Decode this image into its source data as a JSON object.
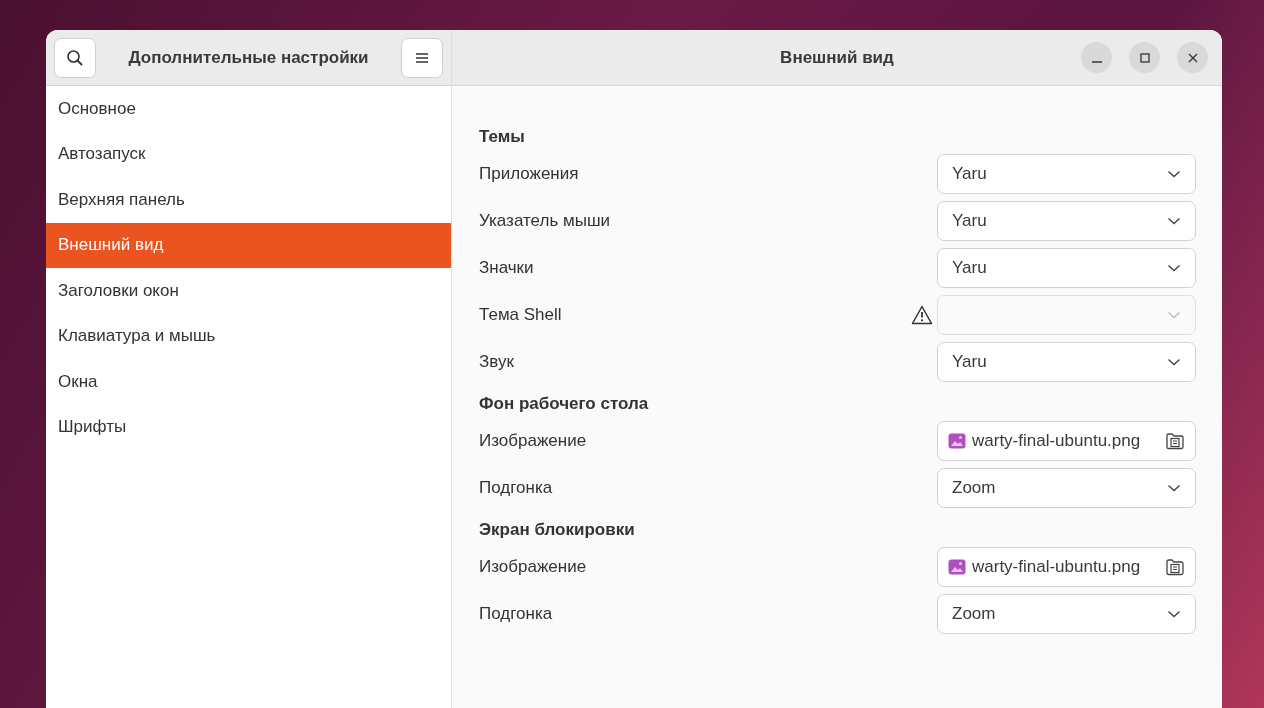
{
  "sidebar": {
    "title": "Дополнительные настройки",
    "items": [
      {
        "label": "Основное",
        "selected": false
      },
      {
        "label": "Автозапуск",
        "selected": false
      },
      {
        "label": "Верхняя панель",
        "selected": false
      },
      {
        "label": "Внешний вид",
        "selected": true
      },
      {
        "label": "Заголовки окон",
        "selected": false
      },
      {
        "label": "Клавиатура и мышь",
        "selected": false
      },
      {
        "label": "Окна",
        "selected": false
      },
      {
        "label": "Шрифты",
        "selected": false
      }
    ]
  },
  "window": {
    "title": "Внешний вид"
  },
  "sections": [
    {
      "title": "Темы",
      "rows": [
        {
          "label": "Приложения",
          "kind": "combo",
          "value": "Yaru",
          "disabled": false,
          "warning": false
        },
        {
          "label": "Указатель мыши",
          "kind": "combo",
          "value": "Yaru",
          "disabled": false,
          "warning": false
        },
        {
          "label": "Значки",
          "kind": "combo",
          "value": "Yaru",
          "disabled": false,
          "warning": false
        },
        {
          "label": "Тема Shell",
          "kind": "combo",
          "disabled": true,
          "warning": true
        },
        {
          "label": "Звук",
          "kind": "combo",
          "value": "Yaru",
          "disabled": false,
          "warning": false
        }
      ]
    },
    {
      "title": "Фон рабочего стола",
      "rows": [
        {
          "label": "Изображение",
          "kind": "file",
          "value": "warty-final-ubuntu.png"
        },
        {
          "label": "Подгонка",
          "kind": "combo",
          "value": "Zoom",
          "disabled": false,
          "warning": false
        }
      ]
    },
    {
      "title": "Экран блокировки",
      "rows": [
        {
          "label": "Изображение",
          "kind": "file",
          "value": "warty-final-ubuntu.png"
        },
        {
          "label": "Подгонка",
          "kind": "combo",
          "value": "Zoom",
          "disabled": false,
          "warning": false
        }
      ]
    }
  ]
}
